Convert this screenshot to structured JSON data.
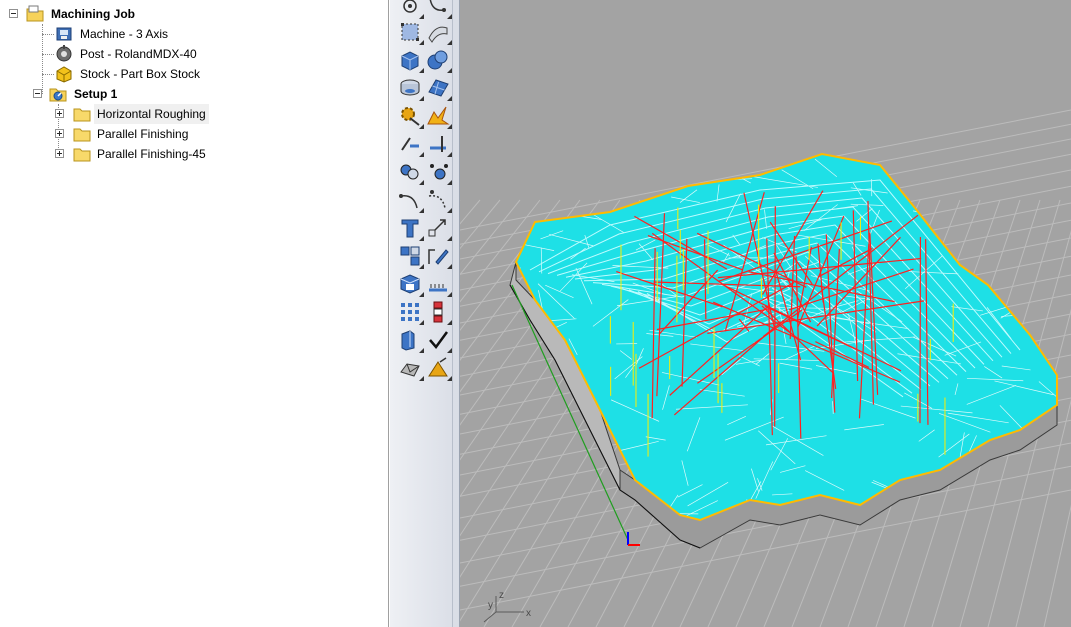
{
  "tree": {
    "root": {
      "label": "Machining Job",
      "icon": "folder-job-icon"
    },
    "machine": {
      "label": "Machine - 3 Axis",
      "icon": "machine-icon"
    },
    "post": {
      "label": "Post - RolandMDX-40",
      "icon": "post-processor-icon"
    },
    "stock": {
      "label": "Stock - Part Box Stock",
      "icon": "stock-box-icon"
    },
    "setup": {
      "label": "Setup 1",
      "icon": "setup-icon"
    },
    "operations": [
      {
        "label": "Horizontal Roughing",
        "icon": "folder-icon",
        "selected": true
      },
      {
        "label": "Parallel Finishing",
        "icon": "folder-icon",
        "selected": false
      },
      {
        "label": "Parallel Finishing-45",
        "icon": "folder-icon",
        "selected": false
      }
    ]
  },
  "toolbar": {
    "buttons": [
      [
        "point-icon",
        "curve-end-icon"
      ],
      [
        "rectangle-select-icon",
        "surface-patch-icon"
      ],
      [
        "box-solid-icon",
        "boolean-spheres-icon"
      ],
      [
        "cylinder-disc-icon",
        "mesh-surface-icon"
      ],
      [
        "gear-transform-icon",
        "explode-icon"
      ],
      [
        "trim-icon",
        "split-icon"
      ],
      [
        "join-circles-icon",
        "points-scatter-icon"
      ],
      [
        "fillet-curve-icon",
        "offset-curve-icon"
      ],
      [
        "text-object-icon",
        "scale-icon"
      ],
      [
        "array-icon",
        "edit-pencil-icon"
      ],
      [
        "block-icon",
        "dimension-icon"
      ],
      [
        "grid-array-icon",
        "stack-icon"
      ],
      [
        "render-icon",
        "check-icon"
      ],
      [
        "shade-icon",
        "material-icon"
      ]
    ]
  },
  "viewport": {
    "axis_labels": {
      "x": "x",
      "y": "y",
      "z": "z"
    },
    "colors": {
      "background": "#a3a3a3",
      "grid": "#bdbdbd",
      "toolpath_roughing": "#00ffff",
      "linking_moves": "#ff2020",
      "plunge_moves": "#ffff00",
      "stock_outline": "#ffbb00",
      "x_axis": "#ff0000",
      "y_axis": "#00aa00",
      "z_axis": "#0000ff"
    }
  }
}
